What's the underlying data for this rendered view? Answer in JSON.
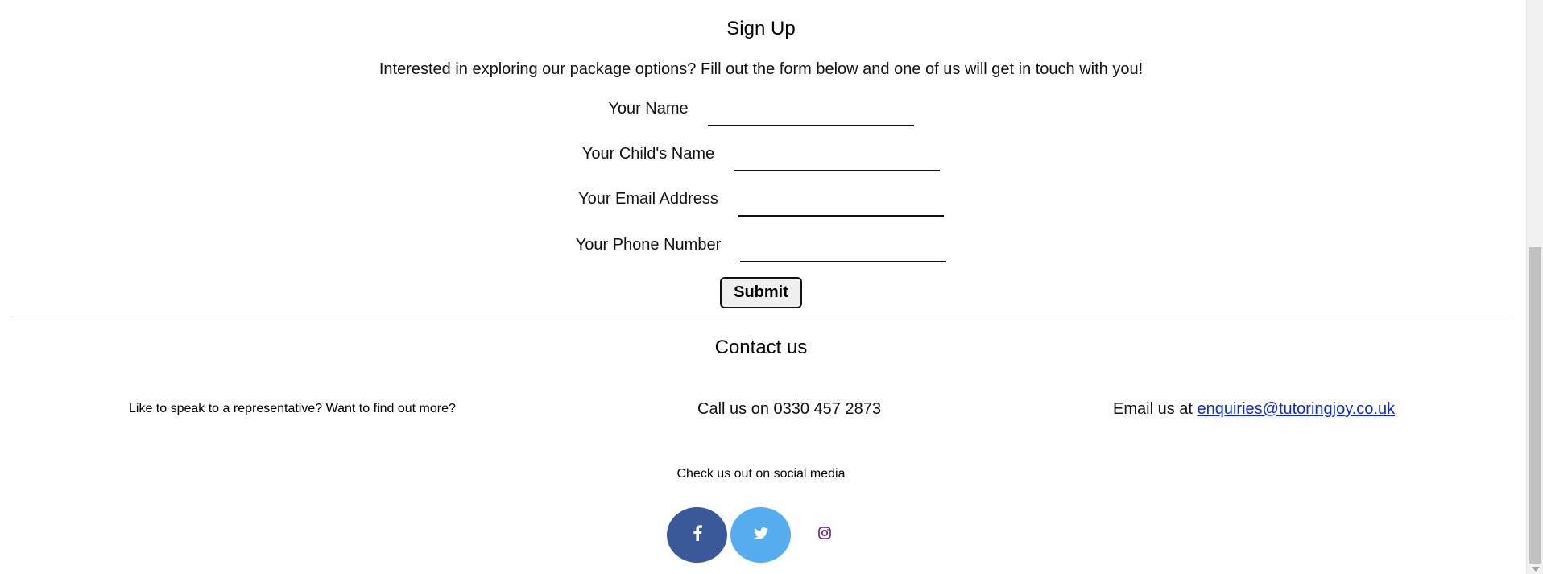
{
  "signup": {
    "title": "Sign Up",
    "intro": "Interested in exploring our package options? Fill out the form below and one of us will get in touch with you!",
    "fields": {
      "name_label": "Your Name",
      "name_value": "",
      "child_label": "Your Child's Name",
      "child_value": "",
      "email_label": "Your Email Address",
      "email_value": "",
      "phone_label": "Your Phone Number",
      "phone_value": ""
    },
    "submit_label": "Submit"
  },
  "contact": {
    "title": "Contact us",
    "speak_text": "Like to speak to a representative? Want to find out more?",
    "call_text": "Call us on 0330 457 2873",
    "email_prefix": "Email us at ",
    "email_link": "enquiries@tutoringjoy.co.uk"
  },
  "social": {
    "title": "Check us out on social media",
    "icons": [
      "facebook-icon",
      "twitter-icon",
      "instagram-icon"
    ],
    "colors": {
      "facebook": "#3b5998",
      "twitter": "#55acee",
      "instagram": "#6a1b78"
    }
  }
}
